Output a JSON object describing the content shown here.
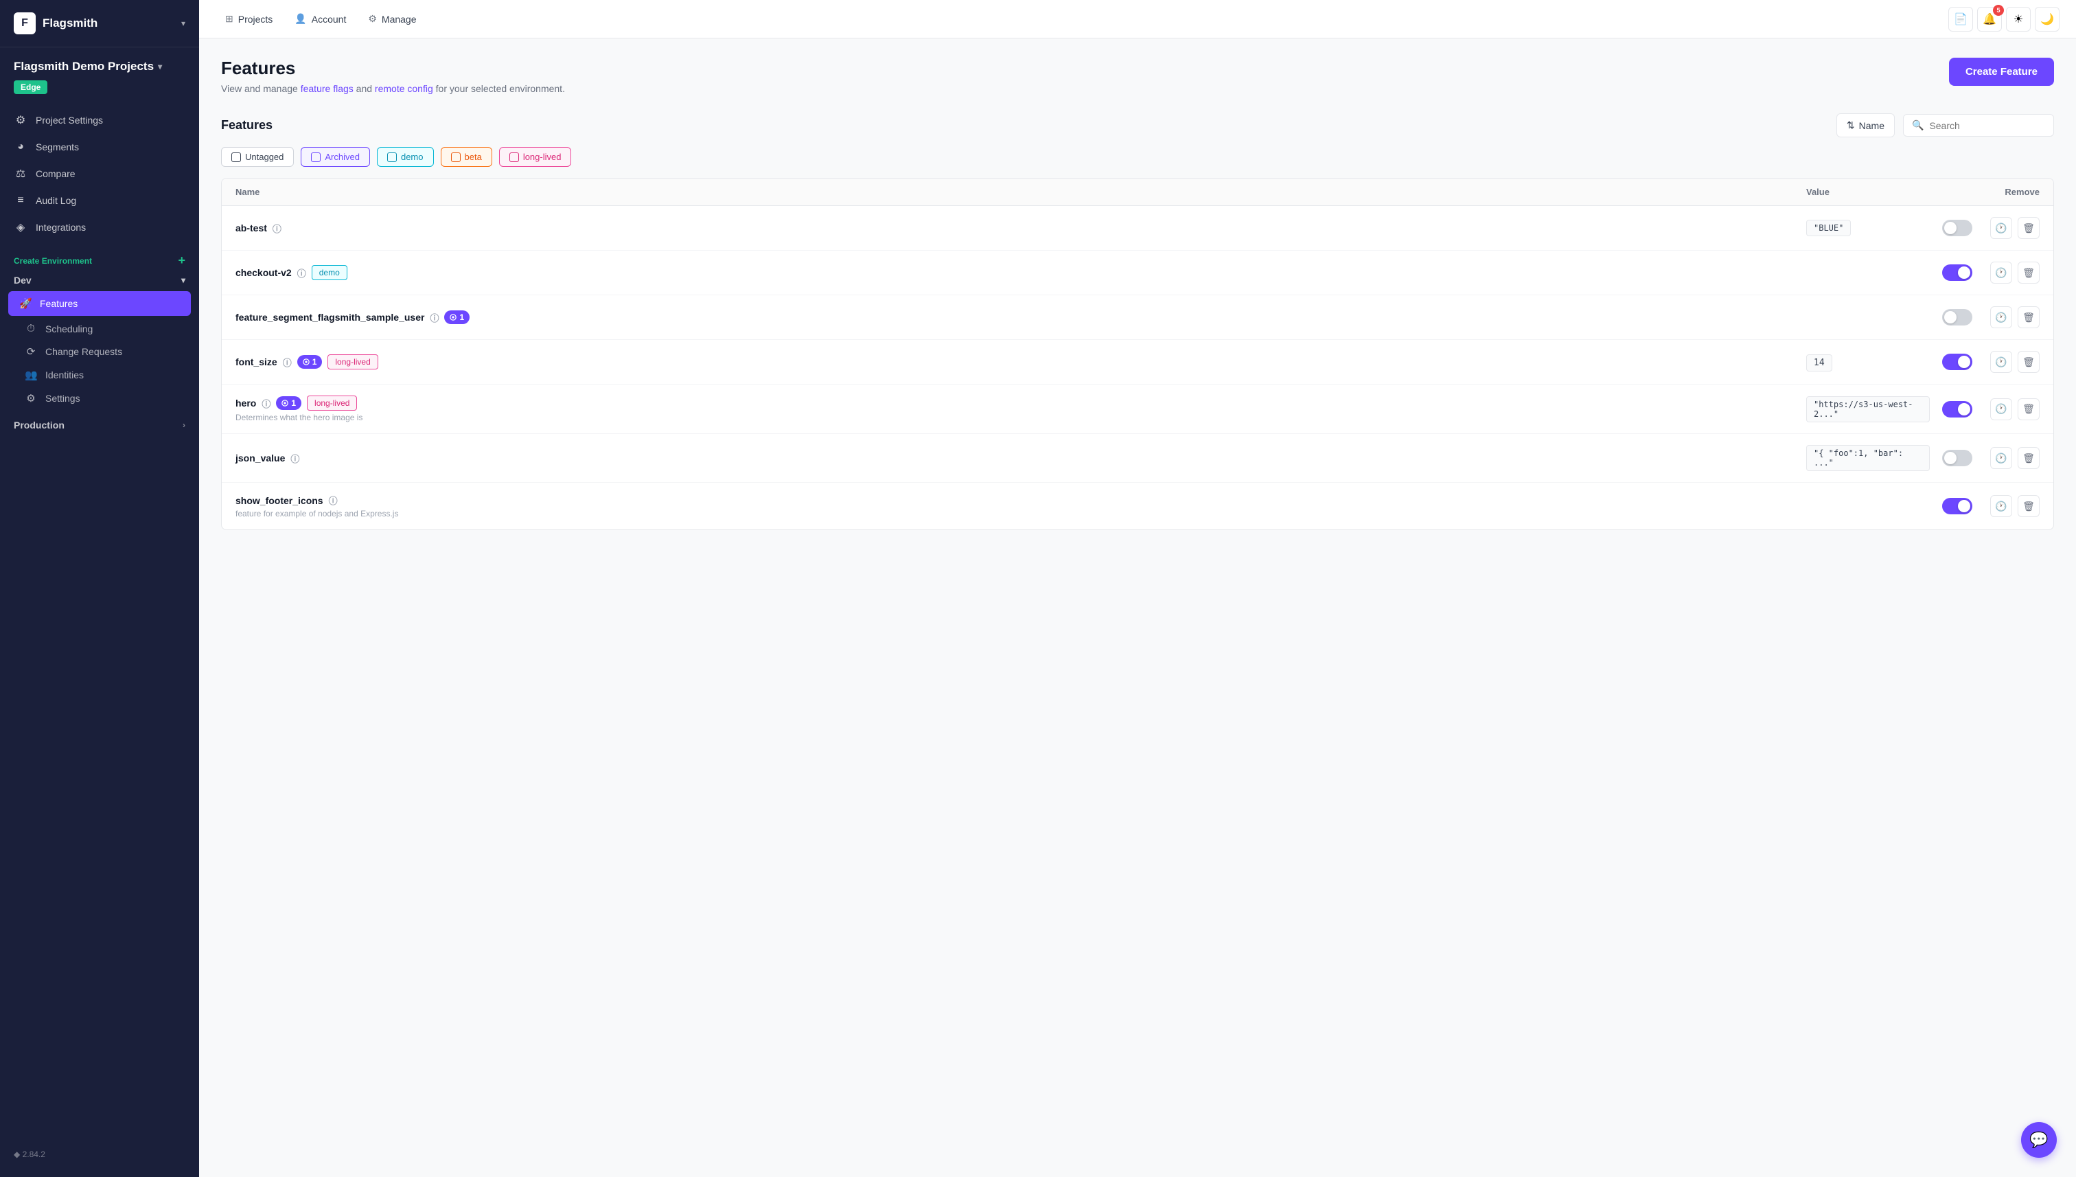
{
  "app": {
    "name": "Flagsmith",
    "logo_letter": "F",
    "version": "2.84.2"
  },
  "project": {
    "name": "Flagsmith Demo Projects",
    "badge": "Edge"
  },
  "sidebar": {
    "nav_items": [
      {
        "id": "project-settings",
        "label": "Project Settings",
        "icon": "⚙"
      },
      {
        "id": "segments",
        "label": "Segments",
        "icon": "◕"
      },
      {
        "id": "compare",
        "label": "Compare",
        "icon": "⚖"
      },
      {
        "id": "audit-log",
        "label": "Audit Log",
        "icon": "≡"
      },
      {
        "id": "integrations",
        "label": "Integrations",
        "icon": "◈"
      }
    ],
    "create_env_label": "Create Environment",
    "env_dev": "Dev",
    "sub_items": [
      {
        "id": "features",
        "label": "Features",
        "icon": "🚀",
        "active": true
      },
      {
        "id": "scheduling",
        "label": "Scheduling",
        "icon": "⏱"
      },
      {
        "id": "change-requests",
        "label": "Change Requests",
        "icon": "⟳"
      },
      {
        "id": "identities",
        "label": "Identities",
        "icon": "👥"
      },
      {
        "id": "settings",
        "label": "Settings",
        "icon": "⚙"
      }
    ],
    "env_production": "Production"
  },
  "topnav": {
    "projects_label": "Projects",
    "account_label": "Account",
    "manage_label": "Manage",
    "notification_count": "5"
  },
  "page": {
    "title": "Features",
    "subtitle_prefix": "View and manage ",
    "subtitle_link1": "feature flags",
    "subtitle_mid": " and ",
    "subtitle_link2": "remote config",
    "subtitle_suffix": " for your selected environment.",
    "create_btn": "Create Feature"
  },
  "features_section": {
    "label": "Features",
    "sort_label": "Name",
    "search_placeholder": "Search"
  },
  "filter_tags": [
    {
      "id": "untagged",
      "label": "Untagged",
      "style": "untagged"
    },
    {
      "id": "archived",
      "label": "Archived",
      "style": "archived"
    },
    {
      "id": "demo",
      "label": "demo",
      "style": "demo"
    },
    {
      "id": "beta",
      "label": "beta",
      "style": "beta"
    },
    {
      "id": "long-lived",
      "label": "long-lived",
      "style": "long-lived"
    }
  ],
  "table": {
    "headers": [
      "Name",
      "Value",
      "",
      "Remove"
    ],
    "rows": [
      {
        "id": "ab-test",
        "name": "ab-test",
        "tags": [],
        "segments": null,
        "value": "\"BLUE\"",
        "enabled": false,
        "description": ""
      },
      {
        "id": "checkout-v2",
        "name": "checkout-v2",
        "tags": [
          "demo"
        ],
        "segments": null,
        "value": "",
        "enabled": true,
        "description": ""
      },
      {
        "id": "feature_segment_flagsmith_sample_user",
        "name": "feature_segment_flagsmith_sample_user",
        "tags": [],
        "segments": "1",
        "value": "",
        "enabled": false,
        "description": ""
      },
      {
        "id": "font_size",
        "name": "font_size",
        "tags": [
          "long-lived"
        ],
        "segments": "1",
        "value": "14",
        "enabled": true,
        "description": ""
      },
      {
        "id": "hero",
        "name": "hero",
        "tags": [
          "long-lived"
        ],
        "segments": "1",
        "value": "\"https://s3-us-west-2...\"",
        "enabled": true,
        "description": "Determines what the hero image is"
      },
      {
        "id": "json_value",
        "name": "json_value",
        "tags": [],
        "segments": null,
        "value": "\"{ \"foo\":1, \"bar\": ...\"",
        "enabled": false,
        "description": ""
      },
      {
        "id": "show_footer_icons",
        "name": "show_footer_icons",
        "tags": [],
        "segments": null,
        "value": "",
        "enabled": true,
        "description": "feature for example of nodejs and Express.js"
      }
    ]
  }
}
